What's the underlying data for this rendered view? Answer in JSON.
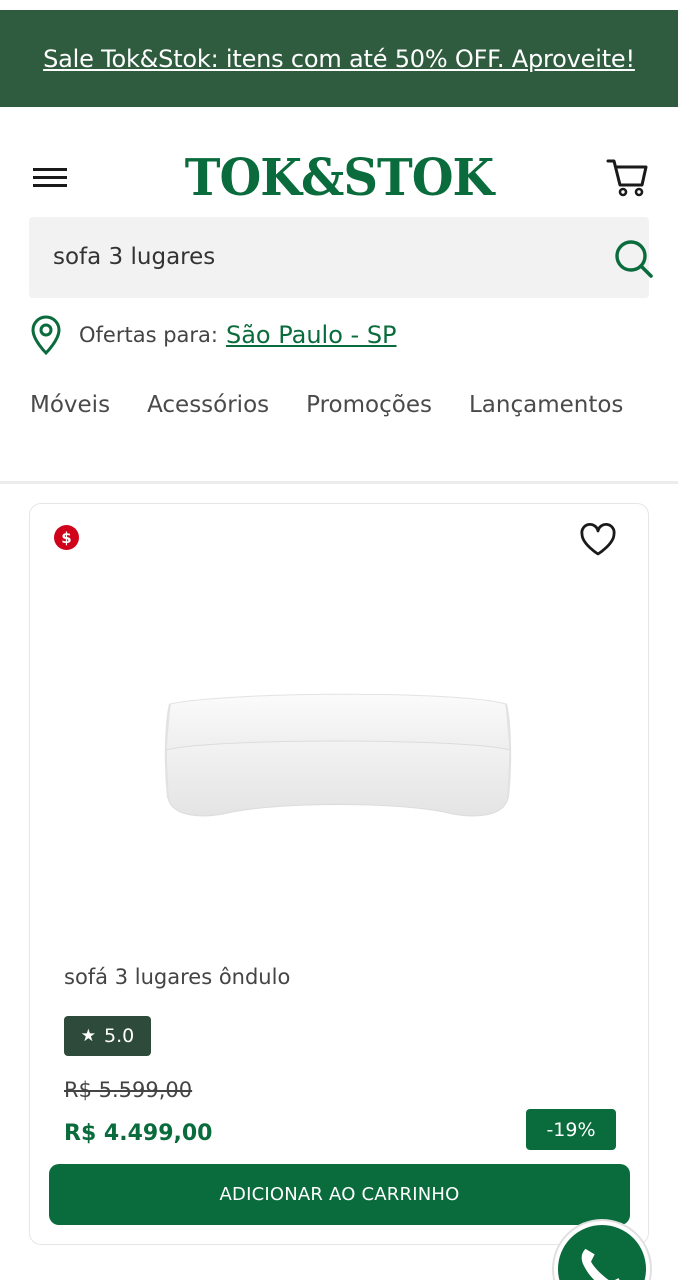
{
  "banner": {
    "text": "Sale Tok&Stok: itens com até 50% OFF. Aproveite!"
  },
  "header": {
    "logo_text": "TOK&STOK",
    "menu_icon": "hamburger-menu-icon",
    "cart_icon": "shopping-cart-icon"
  },
  "search": {
    "value": "sofa 3 lugares",
    "icon": "search-icon"
  },
  "location": {
    "prefix": "Ofertas para:",
    "city": "São Paulo - SP",
    "icon": "map-pin-icon"
  },
  "nav": {
    "items": [
      "Móveis",
      "Acessórios",
      "Promoções",
      "Lançamentos"
    ]
  },
  "product": {
    "sale_badge": "$",
    "name": "sofá 3 lugares ôndulo",
    "rating": "5.0",
    "old_price": "R$ 5.599,00",
    "price": "R$ 4.499,00",
    "discount": "-19%",
    "add_to_cart": "ADICIONAR AO CARRINHO"
  },
  "colors": {
    "brand_green": "#0a6b3c",
    "banner_green": "#2f5b3e",
    "sale_red": "#d0021b",
    "rating_bg": "#2e4a3a"
  },
  "floating": {
    "icon": "whatsapp-icon"
  }
}
